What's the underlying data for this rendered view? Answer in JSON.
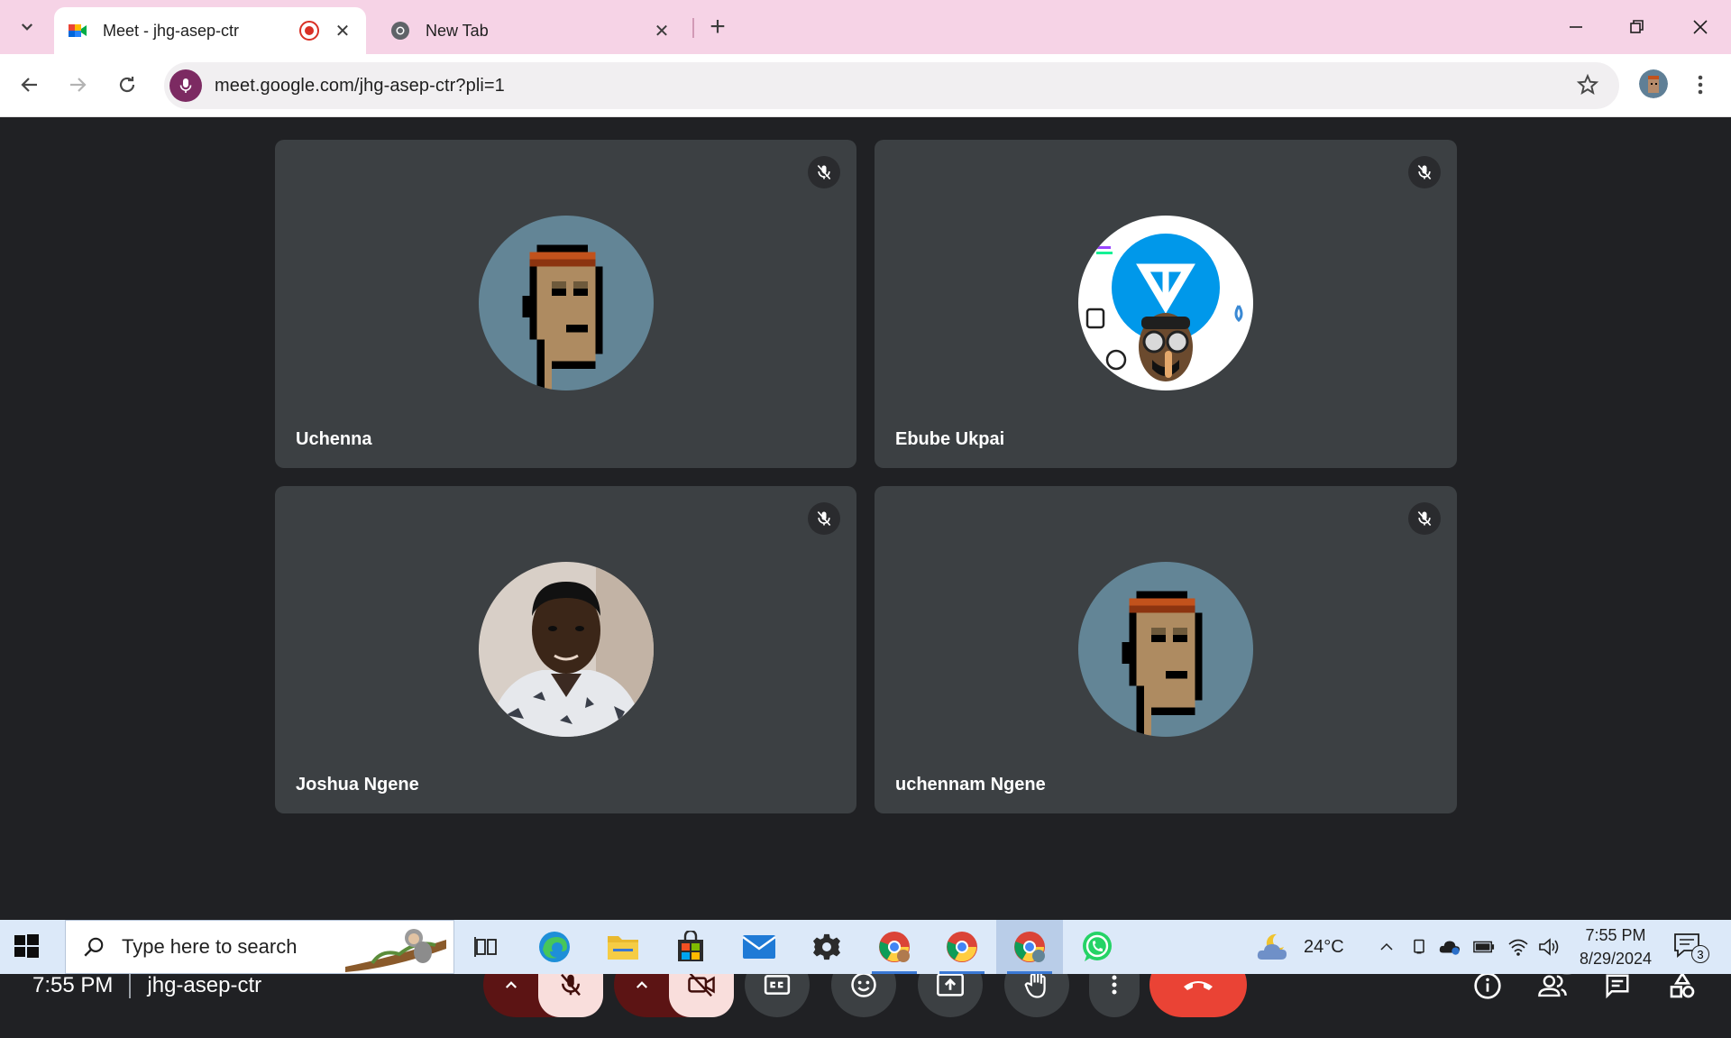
{
  "browser": {
    "tabs": [
      {
        "title": "Meet - jhg-asep-ctr",
        "icon": "google-meet-icon",
        "recording": true,
        "active": true
      },
      {
        "title": "New Tab",
        "icon": "chrome-icon",
        "active": false
      }
    ],
    "url": "meet.google.com/jhg-asep-ctr?pli=1"
  },
  "meeting": {
    "participants": [
      {
        "name": "Uchenna",
        "muted": true,
        "avatar": "pixel-punk-avatar"
      },
      {
        "name": "Ebube Ukpai",
        "muted": true,
        "avatar": "crypto-avatar"
      },
      {
        "name": "Joshua Ngene",
        "muted": true,
        "avatar": "photo-avatar"
      },
      {
        "name": "uchennam Ngene",
        "muted": true,
        "avatar": "pixel-punk-avatar"
      }
    ],
    "time": "7:55 PM",
    "code": "jhg-asep-ctr",
    "people_count": "4"
  },
  "taskbar": {
    "search_placeholder": "Type here to search",
    "temperature": "24°C",
    "time": "7:55 PM",
    "date": "8/29/2024",
    "notifications": "3"
  },
  "colors": {
    "accent_red": "#ea4335",
    "tile_bg": "#3c4043",
    "tabstrip_bg": "#f6d3e6"
  }
}
